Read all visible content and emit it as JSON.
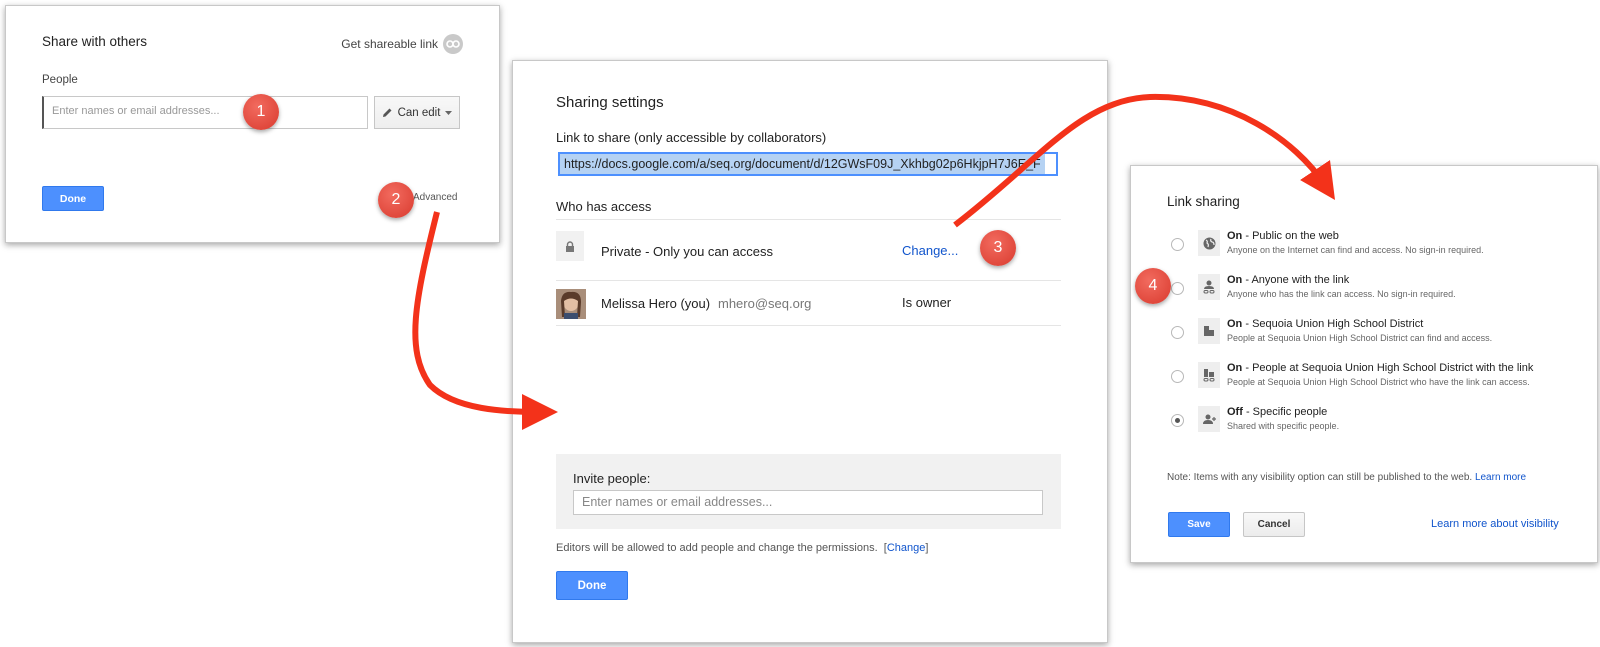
{
  "share_dialog": {
    "title": "Share with others",
    "get_link_label": "Get shareable link",
    "people_label": "People",
    "names_placeholder": "Enter names or email addresses...",
    "permission_label": "Can edit",
    "done_label": "Done",
    "advanced_label": "Advanced"
  },
  "sharing_settings": {
    "title": "Sharing settings",
    "link_label": "Link to share (only accessible by collaborators)",
    "link_url": "https://docs.google.com/a/seq.org/document/d/12GWsF09J_Xkhbg02p6HkjpH7J6E_F",
    "who_has_access_label": "Who has access",
    "access_rows": [
      {
        "label": "Private - Only you can access",
        "action": "Change..."
      },
      {
        "name": "Melissa Hero (you)",
        "email": "mhero@seq.org",
        "role": "Is owner"
      }
    ],
    "invite_label": "Invite people:",
    "invite_placeholder": "Enter names or email addresses...",
    "editors_note": "Editors will be allowed to add people and change the permissions.",
    "editors_change_link": "Change",
    "done_label": "Done"
  },
  "link_sharing": {
    "title": "Link sharing",
    "options": [
      {
        "state": "On",
        "label": "Public on the web",
        "description": "Anyone on the Internet can find and access. No sign-in required.",
        "selected": false,
        "icon": "globe-icon"
      },
      {
        "state": "On",
        "label": "Anyone with the link",
        "description": "Anyone who has the link can access. No sign-in required.",
        "selected": false,
        "icon": "person-link-icon"
      },
      {
        "state": "On",
        "label": "Sequoia Union High School District",
        "description": "People at Sequoia Union High School District can find and access.",
        "selected": false,
        "icon": "building-icon"
      },
      {
        "state": "On",
        "label": "People at Sequoia Union High School District with the link",
        "description": "People at Sequoia Union High School District who have the link can access.",
        "selected": false,
        "icon": "building-link-icon"
      },
      {
        "state": "Off",
        "label": "Specific people",
        "description": "Shared with specific people.",
        "selected": true,
        "icon": "people-icon"
      }
    ],
    "note": "Note: Items with any visibility option can still be published to the web.",
    "note_link": "Learn more",
    "save_label": "Save",
    "cancel_label": "Cancel",
    "learn_more_visibility": "Learn more about visibility"
  },
  "steps": [
    "1",
    "2",
    "3",
    "4"
  ],
  "colors": {
    "accent_blue": "#4d90fe",
    "link_blue": "#1155cc",
    "arrow_red": "#f3321a",
    "badge_red": "#e0473b"
  }
}
